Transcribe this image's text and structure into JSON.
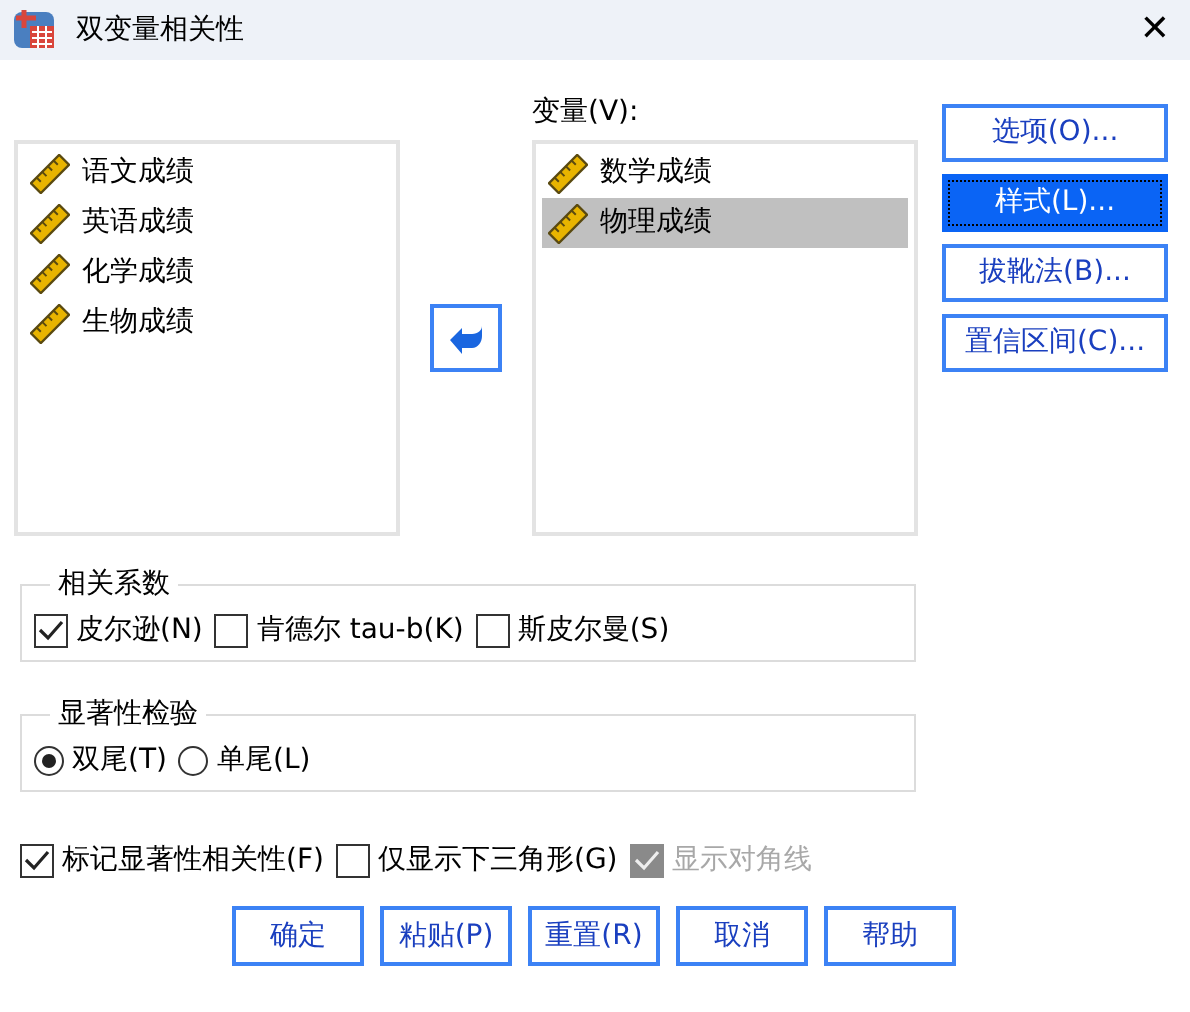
{
  "window": {
    "title": "双变量相关性",
    "close": "✕"
  },
  "source_list": {
    "items": [
      {
        "label": "语文成绩",
        "selected": false
      },
      {
        "label": "英语成绩",
        "selected": false
      },
      {
        "label": "化学成绩",
        "selected": false
      },
      {
        "label": "生物成绩",
        "selected": false
      }
    ]
  },
  "variables": {
    "label": "变量(V):",
    "items": [
      {
        "label": "数学成绩",
        "selected": false
      },
      {
        "label": "物理成绩",
        "selected": true
      }
    ]
  },
  "side_buttons": [
    {
      "label": "选项(O)...",
      "selected": false
    },
    {
      "label": "样式(L)...",
      "selected": true
    },
    {
      "label": "拔靴法(B)...",
      "selected": false
    },
    {
      "label": "置信区间(C)...",
      "selected": false
    }
  ],
  "correlation_coefficients": {
    "title": "相关系数",
    "options": [
      {
        "label": "皮尔逊(N)",
        "checked": true
      },
      {
        "label": "肯德尔 tau-b(K)",
        "checked": false
      },
      {
        "label": "斯皮尔曼(S)",
        "checked": false
      }
    ]
  },
  "significance_test": {
    "title": "显著性检验",
    "options": [
      {
        "label": "双尾(T)",
        "selected": true
      },
      {
        "label": "单尾(L)",
        "selected": false
      }
    ]
  },
  "flags": [
    {
      "label": "标记显著性相关性(F)",
      "checked": true,
      "disabled": false
    },
    {
      "label": "仅显示下三角形(G)",
      "checked": false,
      "disabled": false
    },
    {
      "label": "显示对角线",
      "checked": true,
      "disabled": true
    }
  ],
  "buttons": [
    "确定",
    "粘贴(P)",
    "重置(R)",
    "取消",
    "帮助"
  ]
}
